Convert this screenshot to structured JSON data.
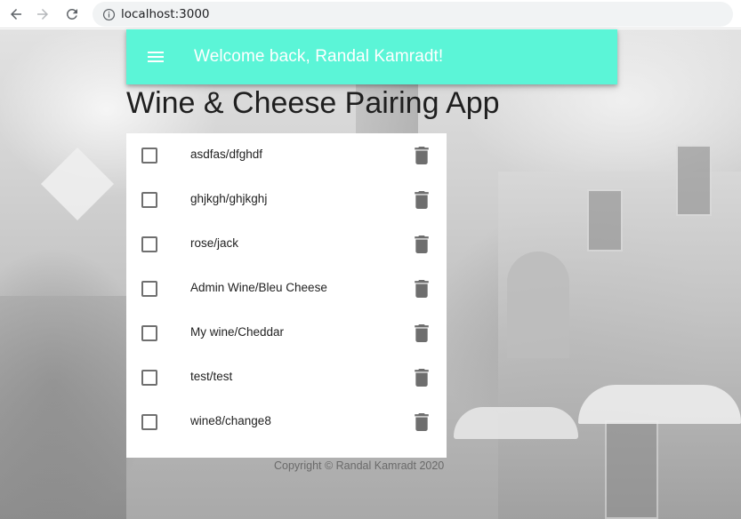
{
  "browser": {
    "url": "localhost:3000",
    "back_icon": "arrow-left-icon",
    "forward_icon": "arrow-right-icon",
    "reload_icon": "reload-icon",
    "info_icon": "info-icon"
  },
  "app_bar": {
    "title": "Welcome back, Randal Kamradt!",
    "menu_icon": "hamburger-menu-icon",
    "color": "#5bf5d7"
  },
  "heading": "Wine & Cheese Pairing App",
  "pairings": [
    {
      "label": "asdfas/dfghdf",
      "checked": false
    },
    {
      "label": "ghjkgh/ghjkghj",
      "checked": false
    },
    {
      "label": "rose/jack",
      "checked": false
    },
    {
      "label": "Admin Wine/Bleu Cheese",
      "checked": false
    },
    {
      "label": "My wine/Cheddar",
      "checked": false
    },
    {
      "label": "test/test",
      "checked": false
    },
    {
      "label": "wine8/change8",
      "checked": false
    }
  ],
  "delete_icon": "trash-icon",
  "footer": "Copyright © Randal Kamradt 2020"
}
